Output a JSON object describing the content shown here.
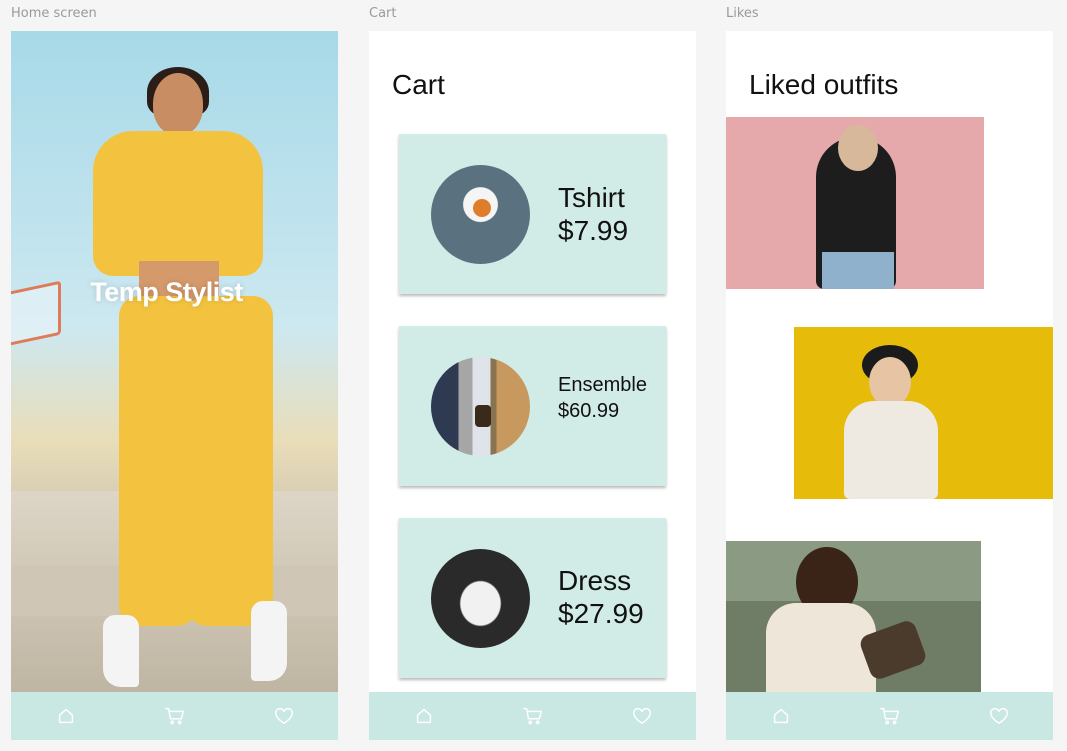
{
  "frames": {
    "home": {
      "label": "Home screen",
      "app_title": "Temp Stylist"
    },
    "cart": {
      "label": "Cart",
      "title": "Cart",
      "items": [
        {
          "name": "Tshirt",
          "price": "$7.99"
        },
        {
          "name": "Ensemble",
          "price": "$60.99"
        },
        {
          "name": "Dress",
          "price": "$27.99"
        }
      ]
    },
    "likes": {
      "label": "Likes",
      "title": "Liked outfits"
    }
  },
  "navbar": {
    "icons": [
      "home-icon",
      "cart-icon",
      "heart-icon"
    ],
    "background": "#c9e7e3"
  },
  "colors": {
    "card_background": "#d1ebe6",
    "page_background": "#f5f5f5"
  }
}
